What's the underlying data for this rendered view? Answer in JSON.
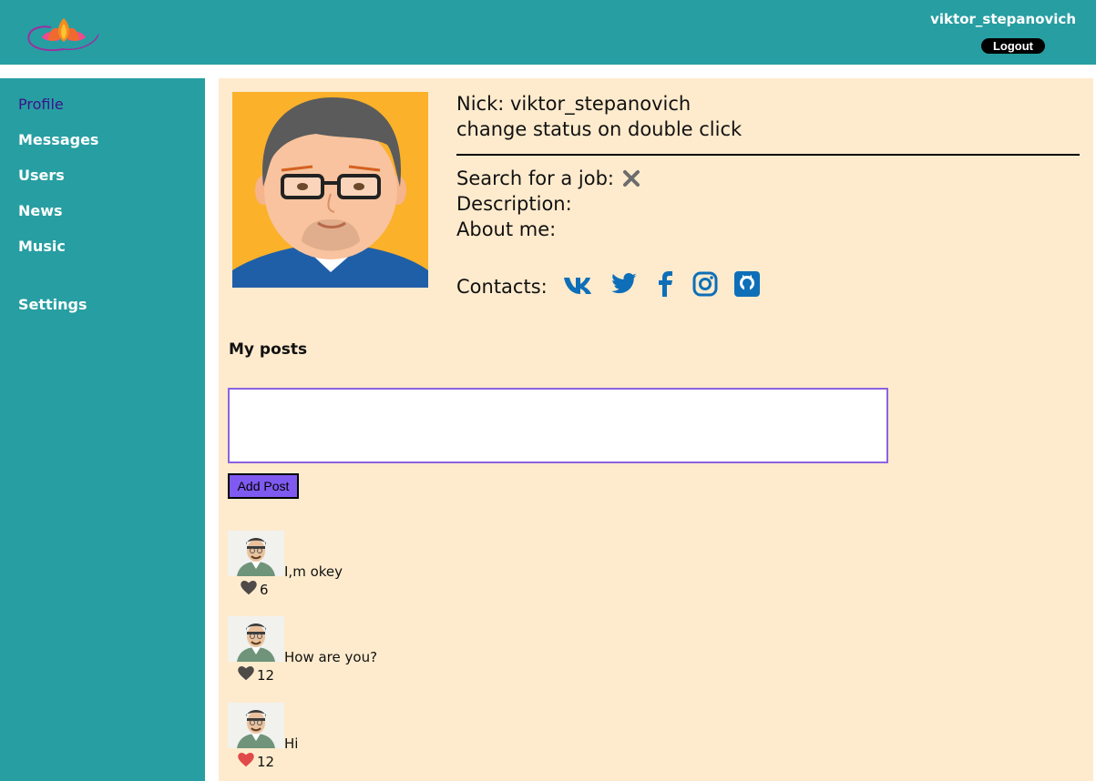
{
  "header": {
    "username": "viktor_stepanovich",
    "logout_label": "Logout"
  },
  "sidebar": {
    "items": [
      {
        "label": "Profile",
        "active": true
      },
      {
        "label": "Messages"
      },
      {
        "label": "Users"
      },
      {
        "label": "News"
      },
      {
        "label": "Music"
      },
      {
        "label": "Settings"
      }
    ]
  },
  "profile": {
    "nick": "Nick: viktor_stepanovich",
    "status": "change status on double click",
    "job_label": "Search for a job:",
    "job_icon": "close-icon",
    "description_label": "Description:",
    "about_label": "About me:",
    "contacts_label": "Contacts:",
    "contacts": [
      "vk-icon",
      "twitter-icon",
      "facebook-icon",
      "instagram-icon",
      "github-icon"
    ],
    "contact_color": "#0e6fb8"
  },
  "posts": {
    "title": "My posts",
    "input_value": "",
    "add_label": "Add Post",
    "items": [
      {
        "text": "I,m okey",
        "likes": "6",
        "liked": false
      },
      {
        "text": "How are you?",
        "likes": "12",
        "liked": false
      },
      {
        "text": "Hi",
        "likes": "12",
        "liked": true
      }
    ]
  },
  "colors": {
    "primary": "#279ea2",
    "content_bg": "#feebcd",
    "button": "#7f5af0",
    "like_active": "#e04a4a",
    "like_inactive": "#4d4a48"
  }
}
